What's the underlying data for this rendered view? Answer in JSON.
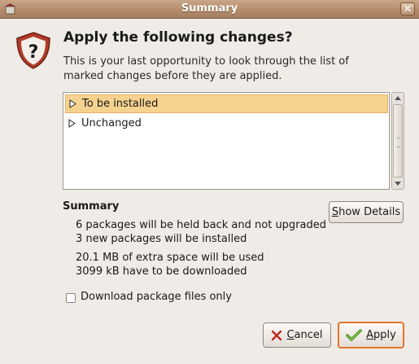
{
  "window": {
    "title": "Summary"
  },
  "dialog": {
    "heading": "Apply the following changes?",
    "description": "This is your last opportunity to look through the list of marked changes before they are applied."
  },
  "changes_list": [
    {
      "label": "To be installed",
      "selected": true
    },
    {
      "label": "Unchanged",
      "selected": false
    }
  ],
  "summary": {
    "title": "Summary",
    "lines": [
      "6 packages will be held back and not upgraded",
      "3 new packages will be installed",
      "20.1 MB of extra space will be used",
      "3099 kB have to be downloaded"
    ],
    "details_button": {
      "mnemonic": "S",
      "rest": "how Details"
    }
  },
  "options": {
    "download_only_label": "Download package files only",
    "download_only_checked": false
  },
  "buttons": {
    "cancel": {
      "mnemonic": "C",
      "rest": "ancel"
    },
    "apply": {
      "mnemonic": "A",
      "rest": "pply"
    }
  },
  "icons": [
    "app-icon",
    "close-icon",
    "question-icon",
    "expander-icon",
    "cancel-x-icon",
    "apply-check-icon"
  ],
  "colors": {
    "titlebar": "#b48c6c",
    "selection": "#f6d28e",
    "focus_border": "#e2742f",
    "background": "#efebe7"
  }
}
